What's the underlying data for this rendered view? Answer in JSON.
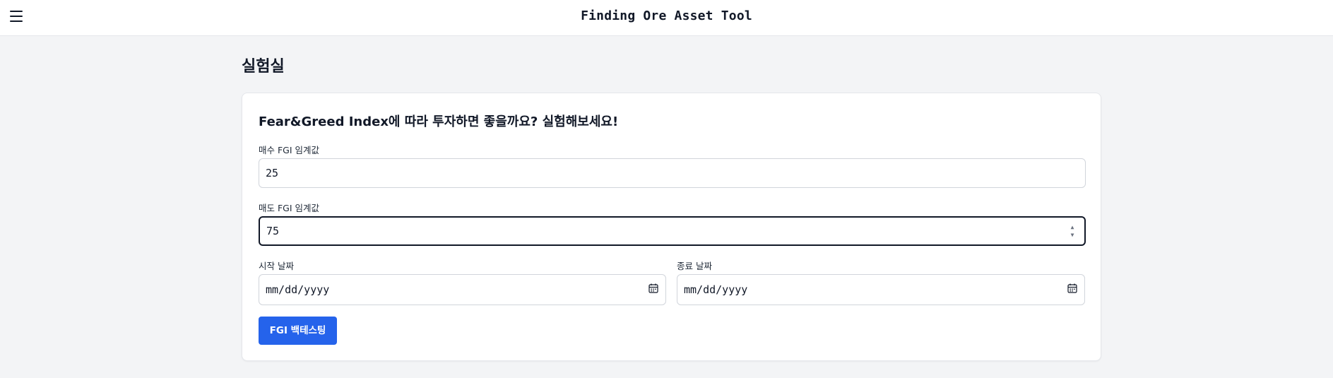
{
  "header": {
    "title": "Finding Ore Asset Tool",
    "menu_icon": "hamburger-menu-icon"
  },
  "page": {
    "title": "실험실"
  },
  "card": {
    "title": "Fear&Greed Index에 따라 투자하면 좋을까요? 실험해보세요!",
    "buy_label": "매수 FGI 임계값",
    "buy_value": "25",
    "sell_label": "매도 FGI 임계값",
    "sell_value": "75",
    "start_label": "시작 날짜",
    "start_value": "mm/dd/yyyy",
    "end_label": "종료 날짜",
    "end_value": "mm/dd/yyyy",
    "button_label": "FGI 백테스팅",
    "calendar_icon": "calendar-icon"
  },
  "colors": {
    "primary": "#2563eb",
    "background": "#f3f4f6"
  }
}
